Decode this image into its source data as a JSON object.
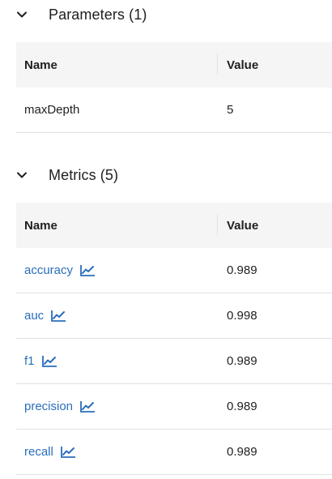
{
  "parameters": {
    "title": "Parameters (1)",
    "columns": {
      "name": "Name",
      "value": "Value"
    },
    "rows": [
      {
        "name": "maxDepth",
        "value": "5"
      }
    ]
  },
  "metrics": {
    "title": "Metrics (5)",
    "columns": {
      "name": "Name",
      "value": "Value"
    },
    "rows": [
      {
        "name": "accuracy",
        "value": "0.989"
      },
      {
        "name": "auc",
        "value": "0.998"
      },
      {
        "name": "f1",
        "value": "0.989"
      },
      {
        "name": "precision",
        "value": "0.989"
      },
      {
        "name": "recall",
        "value": "0.989"
      }
    ]
  },
  "icons": {
    "section_toggle": "chevron-down-icon",
    "metric_chart": "line-chart-icon"
  },
  "colors": {
    "link": "#2a6ebb",
    "header_bg": "#f5f5f5",
    "divider": "#e1e1e1"
  }
}
